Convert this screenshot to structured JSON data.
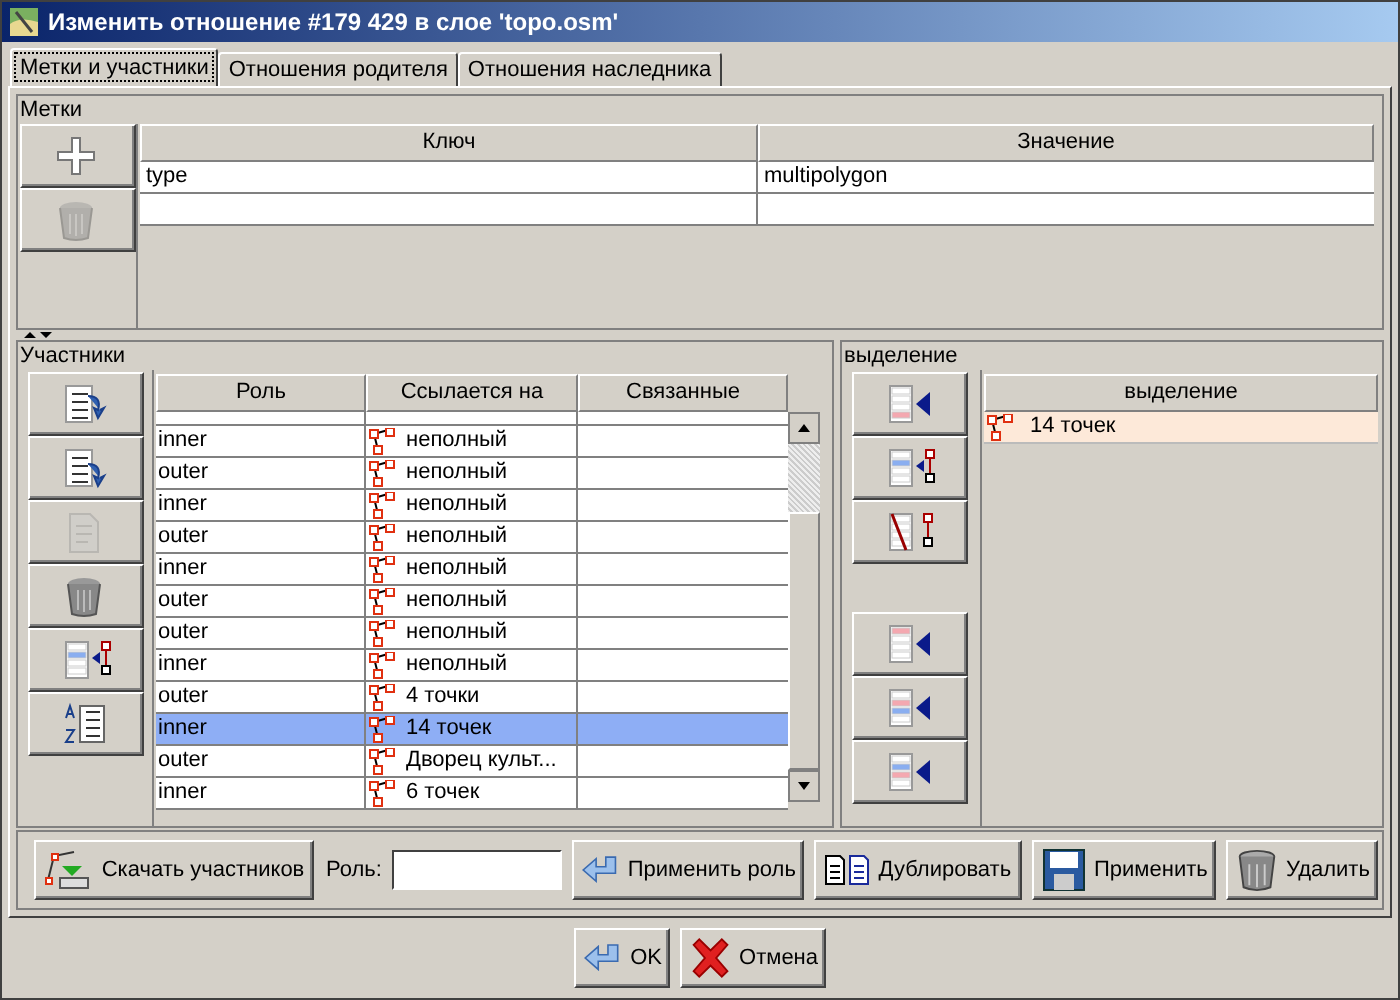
{
  "window": {
    "title": "Изменить отношение #179 429 в слое 'topo.osm'"
  },
  "tabs": [
    {
      "label": "Метки и участники",
      "selected": true
    },
    {
      "label": "Отношения родителя",
      "selected": false
    },
    {
      "label": "Отношения наследника",
      "selected": false
    }
  ],
  "tags": {
    "title": "Метки",
    "buttons": [
      {
        "kind": "add",
        "disabled": false
      },
      {
        "kind": "delete",
        "disabled": true
      }
    ],
    "columns": [
      "Ключ",
      "Значение"
    ],
    "rows": [
      {
        "key": "type",
        "value": "multipolygon"
      },
      {
        "key": "",
        "value": ""
      }
    ]
  },
  "members": {
    "title": "Участники",
    "buttons": [
      {
        "kind": "up",
        "disabled": false
      },
      {
        "kind": "down",
        "disabled": false
      },
      {
        "kind": "edit",
        "disabled": true
      },
      {
        "kind": "delete",
        "disabled": false
      },
      {
        "kind": "select",
        "disabled": false
      },
      {
        "kind": "sort",
        "disabled": false
      }
    ],
    "columns": [
      "Роль",
      "Ссылается на",
      "Связанные"
    ],
    "rows": [
      {
        "role": "inner",
        "ref": "неполный",
        "selected": false
      },
      {
        "role": "outer",
        "ref": "неполный",
        "selected": false
      },
      {
        "role": "inner",
        "ref": "неполный",
        "selected": false
      },
      {
        "role": "outer",
        "ref": "неполный",
        "selected": false
      },
      {
        "role": "inner",
        "ref": "неполный",
        "selected": false
      },
      {
        "role": "outer",
        "ref": "неполный",
        "selected": false
      },
      {
        "role": "outer",
        "ref": "неполный",
        "selected": false
      },
      {
        "role": "inner",
        "ref": "неполный",
        "selected": false
      },
      {
        "role": "outer",
        "ref": "4 точки",
        "selected": false
      },
      {
        "role": "inner",
        "ref": "14 точек",
        "selected": true
      },
      {
        "role": "outer",
        "ref": "Дворец культ...",
        "selected": false
      },
      {
        "role": "inner",
        "ref": "6 точек",
        "selected": false
      }
    ]
  },
  "selection": {
    "title": "выделение",
    "buttons": [
      {
        "kind": "add-end"
      },
      {
        "kind": "select-members"
      },
      {
        "kind": "remove-selected"
      },
      {
        "kind": "add-start"
      },
      {
        "kind": "add-before"
      },
      {
        "kind": "add-after"
      }
    ],
    "column": "выделение",
    "rows": [
      {
        "label": "14 точек"
      }
    ]
  },
  "toolbar": {
    "download": "Скачать участников",
    "role_label": "Роль:",
    "apply_role": "Применить роль",
    "duplicate": "Дублировать",
    "apply": "Применить",
    "delete": "Удалить"
  },
  "buttons": {
    "ok": "OK",
    "cancel": "Отмена"
  }
}
